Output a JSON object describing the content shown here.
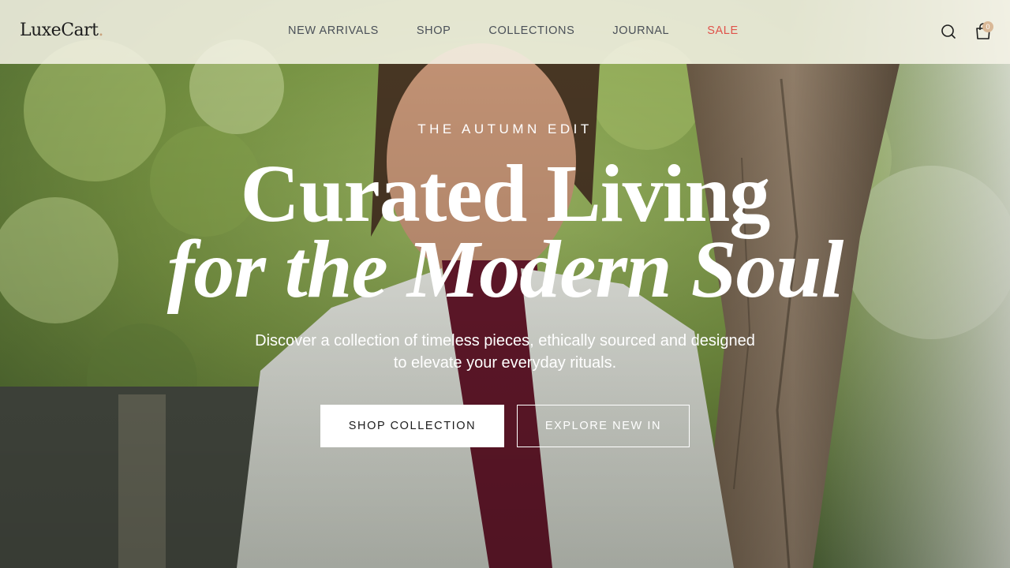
{
  "brand": {
    "logo_text": "LuxeCart",
    "logo_dot": ".",
    "accent_color": "#c9a27a"
  },
  "nav": {
    "items": [
      {
        "label": "NEW ARRIVALS"
      },
      {
        "label": "SHOP"
      },
      {
        "label": "COLLECTIONS"
      },
      {
        "label": "JOURNAL"
      },
      {
        "label": "SALE",
        "color": "#e0524a"
      }
    ]
  },
  "header_actions": {
    "search_icon": "search-icon",
    "cart_icon": "shopping-bag-icon",
    "cart_count": "0"
  },
  "hero": {
    "eyebrow": "THE AUTUMN EDIT",
    "headline_line1": "Curated Living",
    "headline_line2": "for the Modern Soul",
    "subtitle_line1": "Discover a collection of timeless pieces, ethically sourced and designed",
    "subtitle_line2": "to elevate your everyday rituals.",
    "primary_cta": "SHOP COLLECTION",
    "secondary_cta": "EXPLORE NEW IN"
  }
}
